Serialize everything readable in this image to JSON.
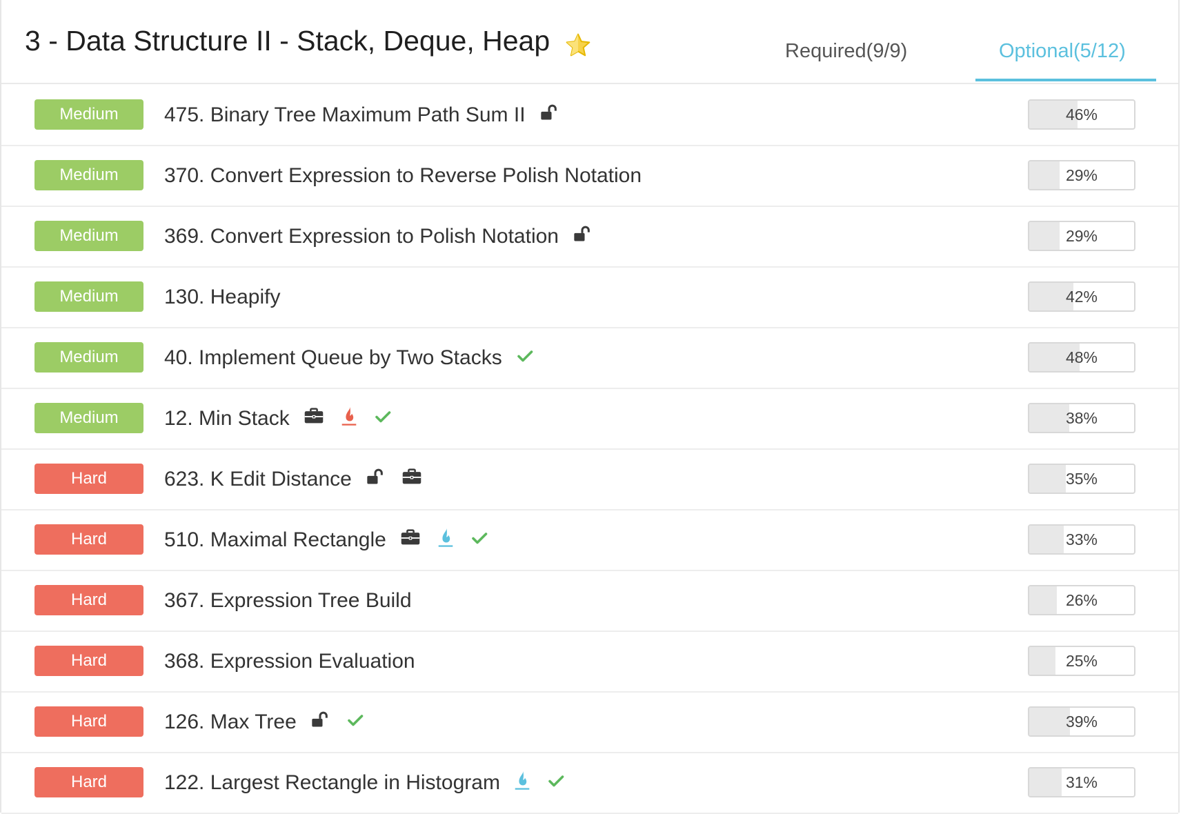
{
  "header": {
    "title": "3 - Data Structure II - Stack, Deque, Heap",
    "tabs": [
      {
        "label": "Required(9/9)",
        "active": false
      },
      {
        "label": "Optional(5/12)",
        "active": true
      }
    ]
  },
  "colors": {
    "medium": "#9ccc65",
    "hard": "#ee6e5e",
    "accent": "#5bc0de",
    "check": "#5cb85c",
    "flame_red": "#e8604c",
    "flame_blue": "#5bc0de"
  },
  "problems": [
    {
      "difficulty": "Medium",
      "title": "475. Binary Tree Maximum Path Sum II",
      "icons": [
        "unlock-icon"
      ],
      "percent": "46%",
      "progress": 0.46
    },
    {
      "difficulty": "Medium",
      "title": "370. Convert Expression to Reverse Polish Notation",
      "icons": [],
      "percent": "29%",
      "progress": 0.29
    },
    {
      "difficulty": "Medium",
      "title": "369. Convert Expression to Polish Notation",
      "icons": [
        "unlock-icon"
      ],
      "percent": "29%",
      "progress": 0.29
    },
    {
      "difficulty": "Medium",
      "title": "130. Heapify",
      "icons": [],
      "percent": "42%",
      "progress": 0.42
    },
    {
      "difficulty": "Medium",
      "title": "40. Implement Queue by Two Stacks",
      "icons": [
        "check-icon"
      ],
      "percent": "48%",
      "progress": 0.48
    },
    {
      "difficulty": "Medium",
      "title": "12. Min Stack",
      "icons": [
        "briefcase-icon",
        "flame-red-icon",
        "check-icon"
      ],
      "percent": "38%",
      "progress": 0.38
    },
    {
      "difficulty": "Hard",
      "title": "623. K Edit Distance",
      "icons": [
        "unlock-icon",
        "briefcase-icon"
      ],
      "percent": "35%",
      "progress": 0.35
    },
    {
      "difficulty": "Hard",
      "title": "510. Maximal Rectangle",
      "icons": [
        "briefcase-icon",
        "flame-blue-icon",
        "check-icon"
      ],
      "percent": "33%",
      "progress": 0.33
    },
    {
      "difficulty": "Hard",
      "title": "367. Expression Tree Build",
      "icons": [],
      "percent": "26%",
      "progress": 0.26
    },
    {
      "difficulty": "Hard",
      "title": "368. Expression Evaluation",
      "icons": [],
      "percent": "25%",
      "progress": 0.25
    },
    {
      "difficulty": "Hard",
      "title": "126. Max Tree",
      "icons": [
        "unlock-icon",
        "check-icon"
      ],
      "percent": "39%",
      "progress": 0.39
    },
    {
      "difficulty": "Hard",
      "title": "122. Largest Rectangle in Histogram",
      "icons": [
        "flame-blue-icon",
        "check-icon"
      ],
      "percent": "31%",
      "progress": 0.31
    }
  ]
}
